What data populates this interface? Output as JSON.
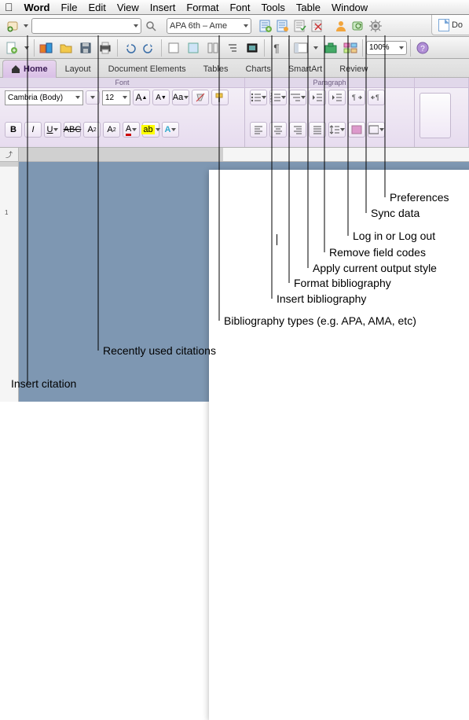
{
  "menubar": {
    "app": "Word",
    "items": [
      "File",
      "Edit",
      "View",
      "Insert",
      "Format",
      "Font",
      "Tools",
      "Table",
      "Window"
    ]
  },
  "citation_bar": {
    "recent_combo": "",
    "style_combo": "APA 6th – Ame",
    "doc_tab": "Do"
  },
  "std_bar": {
    "zoom": "100%"
  },
  "ribbon_tabs": [
    "Home",
    "Layout",
    "Document Elements",
    "Tables",
    "Charts",
    "SmartArt",
    "Review"
  ],
  "ribbon": {
    "group_font": "Font",
    "group_para": "Paragraph",
    "font_name": "Cambria (Body)",
    "font_size": "12"
  },
  "ruler_v": [
    "1"
  ],
  "callouts": {
    "insert_citation": "Insert citation",
    "recent": "Recently used citations",
    "bib_types": "Bibliography types (e.g. APA, AMA, etc)",
    "insert_bib": "Insert bibliography",
    "format_bib": "Format bibliography",
    "apply_style": "Apply current output style",
    "remove_codes": "Remove field codes",
    "login": "Log in or Log out",
    "sync": "Sync data",
    "prefs": "Preferences"
  }
}
